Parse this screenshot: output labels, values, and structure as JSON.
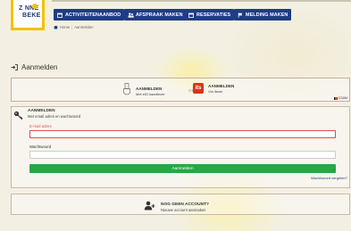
{
  "header": {
    "logo": {
      "line1": "Z NNE",
      "line2": "BEKE"
    },
    "nav": [
      {
        "label": "ACTIVITEITENAANBOD",
        "icon": "calendar-icon"
      },
      {
        "label": "AFSPRAAK MAKEN",
        "icon": "users-icon"
      },
      {
        "label": "RESERVATIES",
        "icon": "calendar-icon"
      },
      {
        "label": "MELDING MAKEN",
        "icon": "flag-icon"
      }
    ]
  },
  "breadcrumb": {
    "home": "Home",
    "current": "Aanmelden"
  },
  "page": {
    "title": "Aanmelden"
  },
  "federal_login": {
    "eid": {
      "title": "AANMELDEN",
      "subtitle": "Met eID kaartlezer"
    },
    "separator": "OF",
    "itsme": {
      "title": "AANMELDEN",
      "subtitle": "Via itsme",
      "icon_text": "its"
    },
    "language": "CSAM"
  },
  "account_login": {
    "title": "AANMELDEN",
    "subtitle": "Met email adres en wachtwoord",
    "email_label": "E-mail adres",
    "email_value": "",
    "password_label": "Wachtwoord",
    "password_value": "",
    "submit_label": "Aanmelden",
    "forgot_label": "Wachtwoord vergeten?"
  },
  "register": {
    "title": "NOG GEEN ACCOUNT?",
    "subtitle": "Nieuwe account aanmaken"
  },
  "colors": {
    "nav": "#1f3c84",
    "accent": "#f2c200",
    "submit": "#28a745",
    "error": "#d9534f",
    "itsme": "#e0301e"
  }
}
